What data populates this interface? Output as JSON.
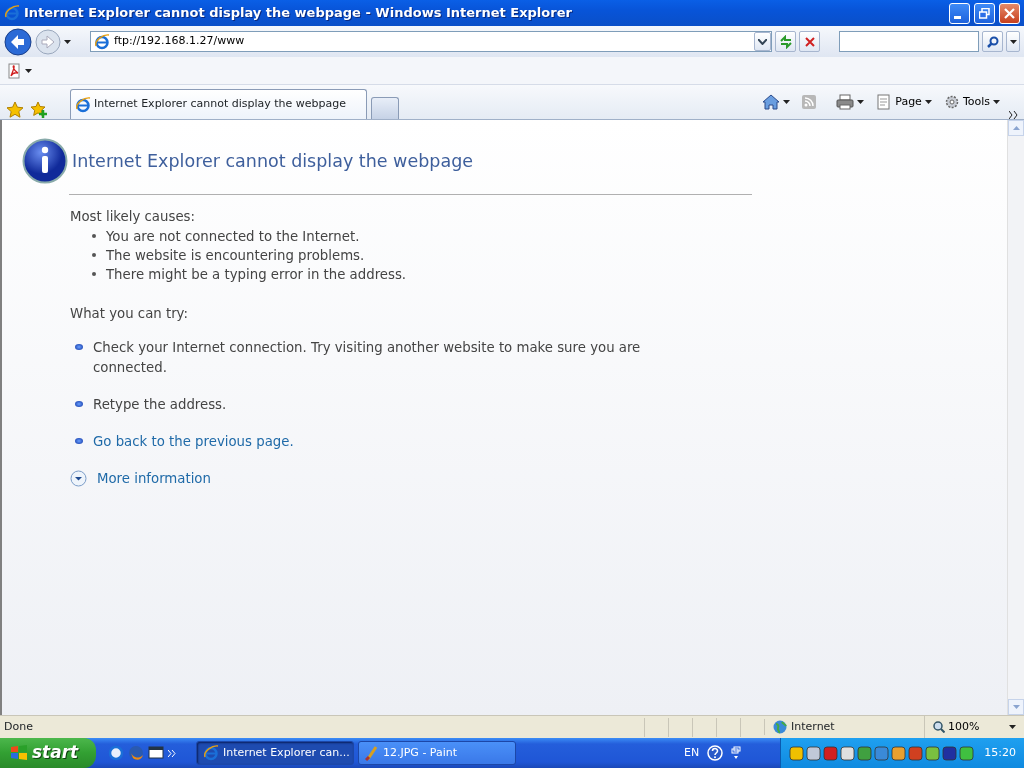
{
  "window": {
    "title": "Internet Explorer cannot display the webpage - Windows Internet Explorer"
  },
  "address_bar": {
    "url": "ftp://192.168.1.27/www"
  },
  "tabs": [
    {
      "label": "Internet Explorer cannot display the webpage",
      "selected": true
    }
  ],
  "command_bar": [
    {
      "label": "Page"
    },
    {
      "label": "Tools"
    }
  ],
  "page": {
    "heading": "Internet Explorer cannot display the webpage",
    "causes_label": "Most likely causes:",
    "causes": [
      "You are not connected to the Internet.",
      "The website is encountering problems.",
      "There might be a typing error in the address."
    ],
    "try_label": "What you can try:",
    "tries": [
      {
        "kind": "text",
        "text": "Check your Internet connection. Try visiting another website to make sure you are connected."
      },
      {
        "kind": "text",
        "text": "Retype the address."
      },
      {
        "kind": "link",
        "text": "Go back to the previous page."
      }
    ],
    "more_info": "More information"
  },
  "status_bar": {
    "text": "Done",
    "zone": "Internet",
    "zoom": "100%"
  },
  "taskbar": {
    "start": "start",
    "tasks": [
      {
        "label": "Internet Explorer can...",
        "selected": true
      },
      {
        "label": "12.JPG - Paint",
        "selected": false
      }
    ],
    "language": "EN",
    "clock": "15:20"
  }
}
